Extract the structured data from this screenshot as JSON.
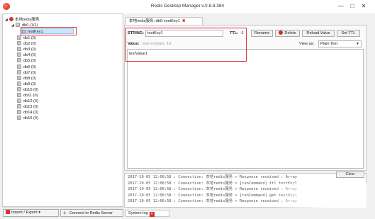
{
  "window": {
    "title": "Redis Desktop Manager v.0.8.8.384",
    "minimize_glyph": "—",
    "maximize_glyph": "□",
    "close_glyph": "✕"
  },
  "tree": {
    "server": "本地redis服务",
    "db0_label": "db0  (1/1)",
    "selected_key": "testKey1",
    "databases": [
      "db1  (0)",
      "db2  (0)",
      "db3  (0)",
      "db4  (0)",
      "db5  (0)",
      "db6  (0)",
      "db7  (0)",
      "db8  (0)",
      "db9  (0)",
      "db10  (0)",
      "db11  (0)",
      "db12  (0)",
      "db13  (0)",
      "db14  (0)",
      "db15  (0)"
    ]
  },
  "bottom_buttons": {
    "import_export": "Import / Export",
    "import_export_arrow": "▾",
    "connect": "Connect to Redis Server"
  },
  "tab": {
    "label": "本地redis服务::db0::testKey1",
    "close_glyph": "✖"
  },
  "editor": {
    "type_label": "STRING:",
    "key_value": "testKey1",
    "ttl_label": "TTL:",
    "ttl_value": "-1",
    "rename": "Rename",
    "delete": "Delete",
    "reload": "Reload Value",
    "set_ttl": "Set TTL",
    "value_label": "Value:",
    "value_placeholder": "size in bytes: 10",
    "view_as_label": "View as:",
    "view_as_value": "Plain Text",
    "value_text": "testValue1"
  },
  "log": {
    "clear_button": "Clear",
    "lines": [
      "2017-10-05 12:00:58 : Connection: 本地redis服务 > Response received : Array",
      "2017-10-05 12:00:58 : Connection: 本地redis服务 > [runCommand] ttl testKey1",
      "2017-10-05 12:00:58 : Connection: 本地redis服务 > Response received : Array",
      "2017-10-05 12:00:58 : Connection: 本地redis服务 > [runCommand] get testKey1",
      "2017-10-05 12:00:58 : Connection: 本地redis服务 > Response received : Array"
    ]
  },
  "bottom_tab": {
    "label": "System log"
  },
  "colors": {
    "highlight": "#d3343c",
    "accent_red": "#d0302a",
    "selection": "#cde4f7"
  }
}
